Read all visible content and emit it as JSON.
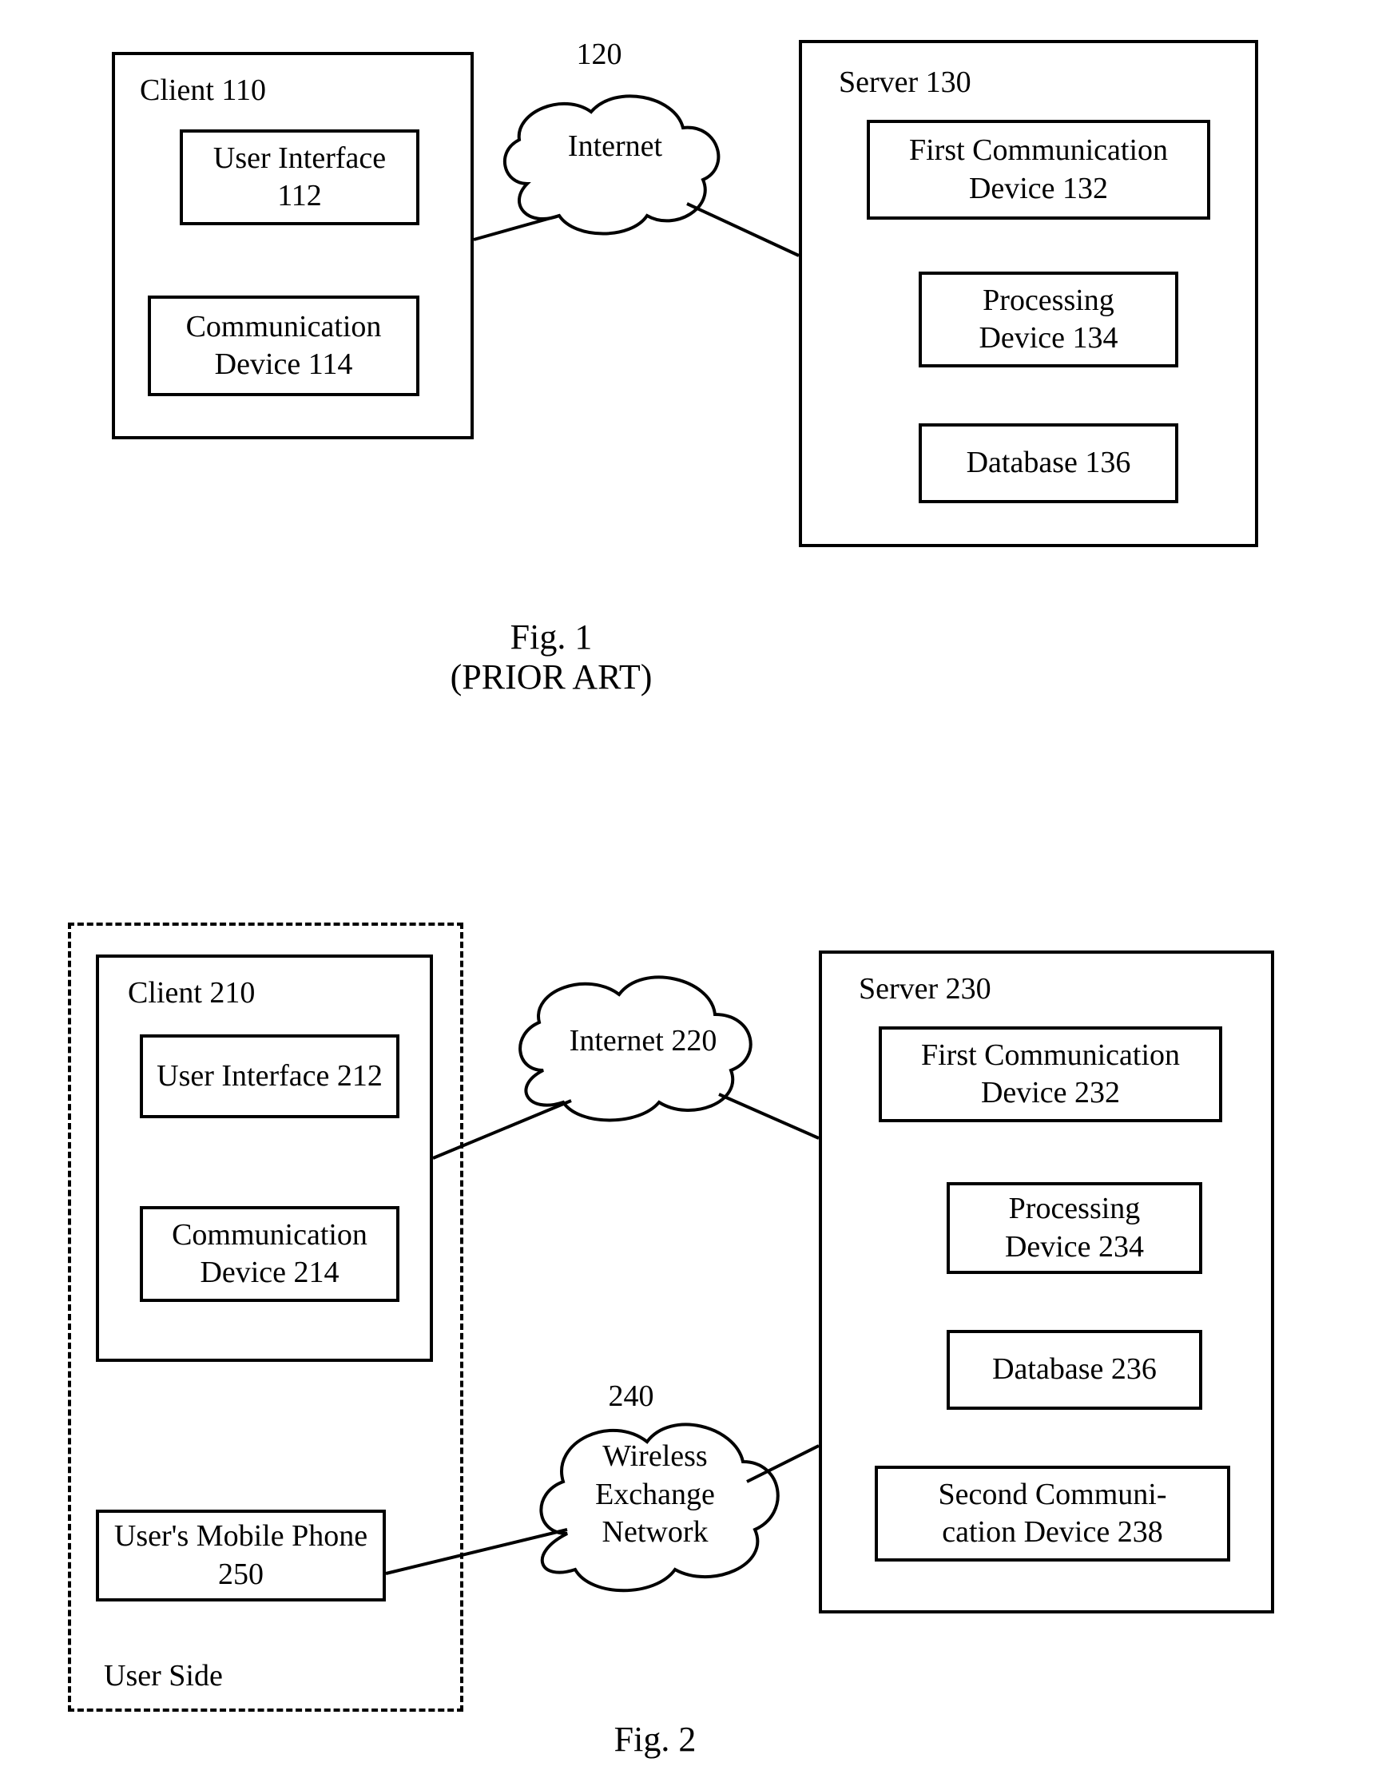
{
  "fig1": {
    "client_title": "Client 110",
    "user_interface": "User Interface\n112",
    "comm_device": "Communication\nDevice 114",
    "internet_num": "120",
    "internet_label": "Internet",
    "server_title": "Server 130",
    "first_comm": "First Communication\nDevice 132",
    "processing": "Processing\nDevice 134",
    "database": "Database 136",
    "caption_line1": "Fig. 1",
    "caption_line2": "(PRIOR ART)"
  },
  "fig2": {
    "user_side": "User Side",
    "client_title": "Client 210",
    "user_interface": "User Interface 212",
    "comm_device": "Communication\nDevice 214",
    "mobile_phone": "User's Mobile Phone\n250",
    "internet_label": "Internet 220",
    "wireless_num": "240",
    "wireless_label": "Wireless\nExchange\nNetwork",
    "server_title": "Server 230",
    "first_comm": "First Communication\nDevice 232",
    "processing": "Processing\nDevice 234",
    "database": "Database 236",
    "second_comm": "Second Communi-\ncation Device 238",
    "caption": "Fig. 2"
  }
}
